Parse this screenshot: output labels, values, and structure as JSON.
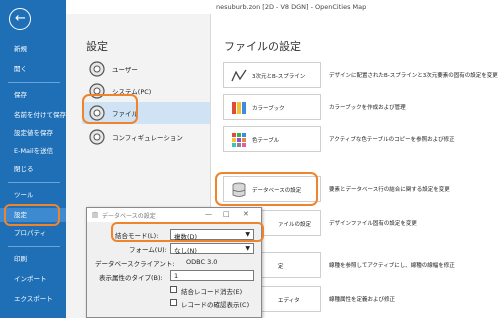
{
  "window": {
    "title": "nesuburb.zon [2D - V8 DGN] - OpenCities Map"
  },
  "sidebar": {
    "back_glyph": "←",
    "items": [
      {
        "label": "新規"
      },
      {
        "label": "開く"
      },
      {
        "label": "保存"
      },
      {
        "label": "名前を付けて保存"
      },
      {
        "label": "設定値を保存"
      },
      {
        "label": "E-Mailを送信"
      },
      {
        "label": "閉じる"
      },
      {
        "label": "ツール"
      },
      {
        "label": "設定"
      },
      {
        "label": "プロパティ"
      },
      {
        "label": "印刷"
      },
      {
        "label": "インポート"
      },
      {
        "label": "エクスポート"
      }
    ]
  },
  "settings": {
    "heading": "設定",
    "items": [
      {
        "label": "ユーザー",
        "icon": "gear-user-icon"
      },
      {
        "label": "システム(PC)",
        "icon": "gear-system-icon"
      },
      {
        "label": "ファイル",
        "icon": "gear-file-icon"
      },
      {
        "label": "コンフィギュレーション",
        "icon": "gear-config-icon"
      }
    ]
  },
  "file_settings": {
    "heading": "ファイルの設定",
    "buttons": [
      {
        "label": "3次元とB-スプライン",
        "description": "デザインに配置されたB-スプラインと3次元要素の固有の設定を変更"
      },
      {
        "label": "カラーブック",
        "description": "カラーブックを作成および管理"
      },
      {
        "label": "色テーブル",
        "description": "アクティブな色テーブルのコピーを参照および修正"
      },
      {
        "label": "データベースの設定",
        "description": "要素とデータベース行の結合に関する設定を変更"
      },
      {
        "label": "ァイルの設定",
        "description": "デザインファイル固有の設定を変更"
      },
      {
        "label": "定",
        "description": "線種を参照してアクティブにし、線種の線幅を修正"
      },
      {
        "label": "エディタ",
        "description": "線種属性を定義および修正"
      }
    ]
  },
  "dialog": {
    "title": "データベースの設定",
    "minimize": "—",
    "restore": "□",
    "close": "✕",
    "combine_mode_label": "結合モード(L):",
    "combine_mode_value": "複数(D)",
    "form_label": "フォーム(U):",
    "form_value": "なし(N)",
    "db_client_label": "データベースクライアント:",
    "db_client_value": "ODBC 3.0",
    "display_type_label": "表示属性のタイプ(B):",
    "display_type_value": "1",
    "checkbox_delete_label": "結合レコード消去(E)",
    "checkbox_confirm_label": "レコードの確認表示(C)"
  },
  "colors": {
    "sidebar_blue": "#1f6fb7",
    "highlight_orange": "#f0842c",
    "selected_item": "#cfe3f5"
  }
}
